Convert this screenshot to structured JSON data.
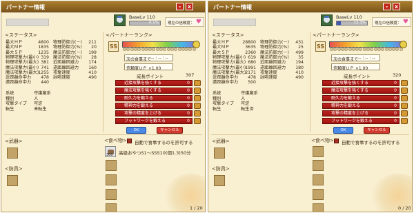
{
  "windows": [
    {
      "title": "パートナー情報",
      "base_lv": "BaseLv 110",
      "lv_progress_text": "0.1%",
      "lv_progress": 0.001,
      "trust_label": "現在の信頼度：",
      "heart_icon": "heart-icon",
      "status_header": "<ステータス>",
      "stats_left": [
        {
          "name": "最大ＨＰ",
          "value": "4800"
        },
        {
          "name": "最大ＭＰ",
          "value": "1835"
        },
        {
          "name": "最大ＳＰ",
          "value": "1235"
        },
        {
          "name": "物理攻撃力(最小)",
          "value": "319"
        },
        {
          "name": "物理攻撃力(最大)",
          "value": "381"
        },
        {
          "name": "魔法攻撃力(最小)",
          "value": "741"
        },
        {
          "name": "魔法攻撃力(最大)",
          "value": "1255"
        },
        {
          "name": "近距離命中力",
          "value": "478"
        },
        {
          "name": "遠距離命中力",
          "value": "440"
        }
      ],
      "stats_right": [
        {
          "name": "物理防御力(－)",
          "value": "211"
        },
        {
          "name": "物理防御力(%)",
          "value": "20"
        },
        {
          "name": "魔法防御力(－)",
          "value": "199"
        },
        {
          "name": "魔法防御力(%)",
          "value": "28"
        },
        {
          "name": "近距離回避力",
          "value": "174"
        },
        {
          "name": "遠距離回避力",
          "value": "160"
        },
        {
          "name": "攻撃速度",
          "value": "410"
        },
        {
          "name": "詠唱速度",
          "value": "490"
        }
      ],
      "info": [
        {
          "k": "系統",
          "v": "守護魔系"
        },
        {
          "k": "種別",
          "v": "人"
        },
        {
          "k": "攻撃タイプ",
          "v": "可逆"
        },
        {
          "k": "転生",
          "v": "未転生"
        }
      ],
      "rank_header": "<パートナーランク>",
      "rank_icon": "SS",
      "rank_dots": [
        0,
        0,
        0,
        0,
        0,
        0,
        0,
        0,
        0,
        0,
        0,
        0,
        0,
        0,
        0,
        0,
        0,
        0,
        0,
        0
      ],
      "next_meal_label": "次の食事まで",
      "next_meal_value": "-- : -- : --",
      "trust_up_label": "信頼度ＵＰ ×1.00",
      "growth_label": "成長ポイント",
      "growth_value": "307",
      "growth_buttons": [
        {
          "label": "近接攻撃を強くする",
          "value": "0"
        },
        {
          "label": "魔法攻撃を強くする",
          "value": "0"
        },
        {
          "label": "耐久力を鍛える",
          "value": "0"
        },
        {
          "label": "精神力を鍛える",
          "value": "0"
        },
        {
          "label": "攻撃の精度を上げる",
          "value": "0"
        },
        {
          "label": "フットワークを鍛える",
          "value": "0"
        }
      ],
      "ok_label": "OK",
      "cancel_label": "キャンセル",
      "weapon_header": "<武器>",
      "armor_header": "<防具>",
      "food_header": "<食べ物>",
      "auto_eat_label": "自動で食事するのを許可する",
      "food_item": "高級おやつS1～SSS10(個1.3)50分",
      "food_icon_qty": "300",
      "page": "1 / 20"
    },
    {
      "title": "パートナー情報",
      "base_lv": "BaseLv 110",
      "lv_progress_text": "13.3%",
      "lv_progress": 0.133,
      "trust_label": "現在の信頼度：",
      "heart_icon": "heart-icon",
      "status_header": "<ステータス>",
      "stats_left": [
        {
          "name": "最大ＨＰ",
          "value": "28800"
        },
        {
          "name": "最大ＭＰ",
          "value": "3635"
        },
        {
          "name": "最大ＳＰ",
          "value": "2360"
        },
        {
          "name": "物理攻撃力(最小)",
          "value": "619"
        },
        {
          "name": "物理攻撃力(最大)",
          "value": "680"
        },
        {
          "name": "魔法攻撃力(最小)",
          "value": "1991"
        },
        {
          "name": "魔法攻撃力(最大)",
          "value": "2171"
        },
        {
          "name": "近距離命中力",
          "value": "478"
        },
        {
          "name": "遠距離命中力",
          "value": "500"
        }
      ],
      "stats_right": [
        {
          "name": "物理防御力(－)",
          "value": "431"
        },
        {
          "name": "物理防御力(%)",
          "value": "25"
        },
        {
          "name": "魔法防御力(－)",
          "value": "499"
        },
        {
          "name": "魔法防御力(%)",
          "value": "35"
        },
        {
          "name": "近距離回避力",
          "value": "194"
        },
        {
          "name": "遠距離回避力",
          "value": "180"
        },
        {
          "name": "攻撃速度",
          "value": "410"
        },
        {
          "name": "詠唱速度",
          "value": "490"
        }
      ],
      "info": [
        {
          "k": "系統",
          "v": "守護魔系"
        },
        {
          "k": "種別",
          "v": "人"
        },
        {
          "k": "攻撃タイプ",
          "v": "可逆"
        },
        {
          "k": "転生",
          "v": "転生済"
        }
      ],
      "rank_header": "<パートナーランク>",
      "rank_icon": "SS",
      "rank_dots": [
        0,
        0,
        0,
        0,
        0,
        0,
        0,
        0,
        0,
        0,
        0,
        0,
        0,
        0,
        0,
        0,
        0,
        0,
        0,
        0
      ],
      "next_meal_label": "次の食事まで",
      "next_meal_value": "-- : -- : --",
      "trust_up_label": "信頼度ＵＰ ×1.00",
      "growth_label": "成長ポイント",
      "growth_value": "320",
      "growth_buttons": [
        {
          "label": "近接攻撃を強くする",
          "value": "0"
        },
        {
          "label": "魔法攻撃を強くする",
          "value": "0"
        },
        {
          "label": "耐久力を鍛える",
          "value": "0"
        },
        {
          "label": "精神力を鍛える",
          "value": "0"
        },
        {
          "label": "攻撃の精度を上げる",
          "value": "0"
        },
        {
          "label": "フットワークを鍛える",
          "value": "0"
        }
      ],
      "ok_label": "OK",
      "cancel_label": "キャンセル",
      "weapon_header": "<武器>",
      "armor_header": "<防具>",
      "food_header": "<食べ物>",
      "auto_eat_label": "自動で食事するのを許可する",
      "food_item": "",
      "food_icon_qty": "",
      "page": "0 / 20"
    }
  ]
}
